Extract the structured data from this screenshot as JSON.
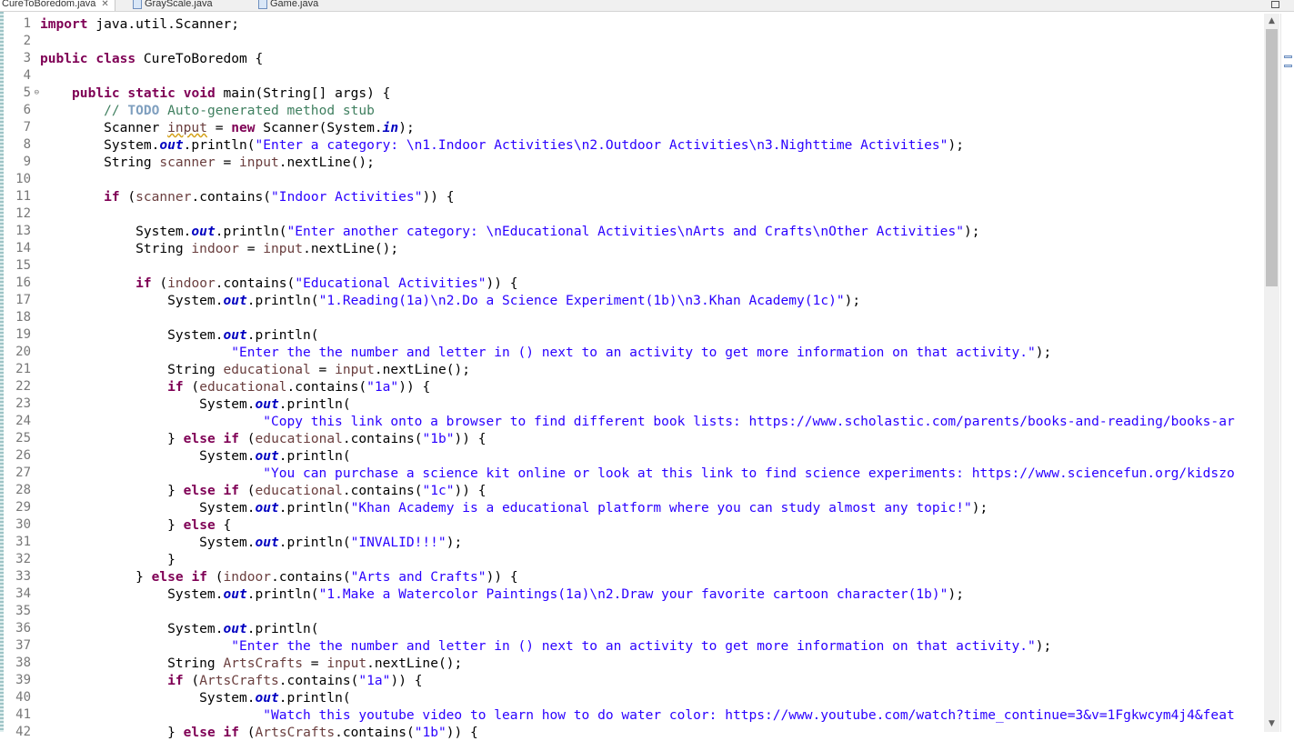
{
  "tabs": [
    {
      "label": "CureToBoredom.java",
      "active": true,
      "close": "✕"
    },
    {
      "label": "GrayScale.java",
      "active": false
    },
    {
      "label": "Game.java",
      "active": false
    }
  ],
  "colors": {
    "keyword": "#7f0055",
    "string": "#2a00ff",
    "comment": "#3f7f5f",
    "todo": "#7f9fbf",
    "static_field": "#0000c0",
    "local_variable": "#6a3e3e"
  },
  "icons": {
    "scroll_up": "▲",
    "scroll_down": "▼",
    "fold_marker": "⊖"
  },
  "line_numbers": [
    "1",
    "2",
    "3",
    "4",
    "5",
    "6",
    "7",
    "8",
    "9",
    "10",
    "11",
    "12",
    "13",
    "14",
    "15",
    "16",
    "17",
    "18",
    "19",
    "20",
    "21",
    "22",
    "23",
    "24",
    "25",
    "26",
    "27",
    "28",
    "29",
    "30",
    "31",
    "32",
    "33",
    "34",
    "35",
    "36",
    "37",
    "38",
    "39",
    "40",
    "41",
    "42"
  ],
  "code": {
    "l1": {
      "kw": "import",
      "rest": " java.util.Scanner;"
    },
    "l3": {
      "kw1": "public",
      "kw2": "class",
      "rest": " CureToBoredom {"
    },
    "l5": {
      "indent": "    ",
      "kw1": "public",
      "kw2": "static",
      "kw3": "void",
      "rest": " main(String[] args) {"
    },
    "l6": {
      "indent": "        ",
      "comment1": "// ",
      "todo": "TODO",
      "comment2": " Auto-generated method stub"
    },
    "l7": {
      "indent": "        ",
      "t1": "Scanner ",
      "var": "input",
      "t2": " = ",
      "kw": "new",
      "t3": " Scanner(System.",
      "field": "in",
      "t4": ");"
    },
    "l8": {
      "indent": "        ",
      "t1": "System.",
      "field": "out",
      "t2": ".println(",
      "str": "\"Enter a category: \\n1.Indoor Activities\\n2.Outdoor Activities\\n3.Nighttime Activities\"",
      "t3": ");"
    },
    "l9": {
      "indent": "        ",
      "t1": "String ",
      "var": "scanner",
      "t2": " = ",
      "var2": "input",
      "t3": ".nextLine();"
    },
    "l11": {
      "indent": "        ",
      "kw": "if",
      "t1": " (",
      "var": "scanner",
      "t2": ".contains(",
      "str": "\"Indoor Activities\"",
      "t3": ")) {"
    },
    "l13": {
      "indent": "            ",
      "t1": "System.",
      "field": "out",
      "t2": ".println(",
      "str": "\"Enter another category: \\nEducational Activities\\nArts and Crafts\\nOther Activities\"",
      "t3": ");"
    },
    "l14": {
      "indent": "            ",
      "t1": "String ",
      "var": "indoor",
      "t2": " = ",
      "var2": "input",
      "t3": ".nextLine();"
    },
    "l16": {
      "indent": "            ",
      "kw": "if",
      "t1": " (",
      "var": "indoor",
      "t2": ".contains(",
      "str": "\"Educational Activities\"",
      "t3": ")) {"
    },
    "l17": {
      "indent": "                ",
      "t1": "System.",
      "field": "out",
      "t2": ".println(",
      "str": "\"1.Reading(1a)\\n2.Do a Science Experiment(1b)\\n3.Khan Academy(1c)\"",
      "t3": ");"
    },
    "l19": {
      "indent": "                ",
      "t1": "System.",
      "field": "out",
      "t2": ".println("
    },
    "l20": {
      "indent": "                        ",
      "str": "\"Enter the the number and letter in () next to an activity to get more information on that activity.\"",
      "t3": ");"
    },
    "l21": {
      "indent": "                ",
      "t1": "String ",
      "var": "educational",
      "t2": " = ",
      "var2": "input",
      "t3": ".nextLine();"
    },
    "l22": {
      "indent": "                ",
      "kw": "if",
      "t1": " (",
      "var": "educational",
      "t2": ".contains(",
      "str": "\"1a\"",
      "t3": ")) {"
    },
    "l23": {
      "indent": "                    ",
      "t1": "System.",
      "field": "out",
      "t2": ".println("
    },
    "l24": {
      "indent": "                            ",
      "str": "\"Copy this link onto a browser to find different book lists: https://www.scholastic.com/parents/books-and-reading/books-ar"
    },
    "l25": {
      "indent": "                ",
      "t0": "} ",
      "kw1": "else",
      "t1": " ",
      "kw2": "if",
      "t2": " (",
      "var": "educational",
      "t3": ".contains(",
      "str": "\"1b\"",
      "t4": ")) {"
    },
    "l26": {
      "indent": "                    ",
      "t1": "System.",
      "field": "out",
      "t2": ".println("
    },
    "l27": {
      "indent": "                            ",
      "str": "\"You can purchase a science kit online or look at this link to find science experiments: https://www.sciencefun.org/kidszo"
    },
    "l28": {
      "indent": "                ",
      "t0": "} ",
      "kw1": "else",
      "t1": " ",
      "kw2": "if",
      "t2": " (",
      "var": "educational",
      "t3": ".contains(",
      "str": "\"1c\"",
      "t4": ")) {"
    },
    "l29": {
      "indent": "                    ",
      "t1": "System.",
      "field": "out",
      "t2": ".println(",
      "str": "\"Khan Academy is a educational platform where you can study almost any topic!\"",
      "t3": ");"
    },
    "l30": {
      "indent": "                ",
      "t0": "} ",
      "kw": "else",
      "t1": " {"
    },
    "l31": {
      "indent": "                    ",
      "t1": "System.",
      "field": "out",
      "t2": ".println(",
      "str": "\"INVALID!!!\"",
      "t3": ");"
    },
    "l32": {
      "indent": "                ",
      "t1": "}"
    },
    "l33": {
      "indent": "            ",
      "t0": "} ",
      "kw1": "else",
      "t1": " ",
      "kw2": "if",
      "t2": " (",
      "var": "indoor",
      "t3": ".contains(",
      "str": "\"Arts and Crafts\"",
      "t4": ")) {"
    },
    "l34": {
      "indent": "                ",
      "t1": "System.",
      "field": "out",
      "t2": ".println(",
      "str": "\"1.Make a Watercolor Paintings(1a)\\n2.Draw your favorite cartoon character(1b)\"",
      "t3": ");"
    },
    "l36": {
      "indent": "                ",
      "t1": "System.",
      "field": "out",
      "t2": ".println("
    },
    "l37": {
      "indent": "                        ",
      "str": "\"Enter the the number and letter in () next to an activity to get more information on that activity.\"",
      "t3": ");"
    },
    "l38": {
      "indent": "                ",
      "t1": "String ",
      "var": "ArtsCrafts",
      "t2": " = ",
      "var2": "input",
      "t3": ".nextLine();"
    },
    "l39": {
      "indent": "                ",
      "kw": "if",
      "t1": " (",
      "var": "ArtsCrafts",
      "t2": ".contains(",
      "str": "\"1a\"",
      "t3": ")) {"
    },
    "l40": {
      "indent": "                    ",
      "t1": "System.",
      "field": "out",
      "t2": ".println("
    },
    "l41": {
      "indent": "                            ",
      "str": "\"Watch this youtube video to learn how to do water color: https://www.youtube.com/watch?time_continue=3&v=1Fgkwcym4j4&feat"
    },
    "l42": {
      "indent": "                ",
      "t0": "} ",
      "kw1": "else",
      "t1": " ",
      "kw2": "if",
      "t2": " (",
      "var": "ArtsCrafts",
      "t3": ".contains(",
      "str": "\"1b\"",
      "t4": ")) {"
    }
  }
}
